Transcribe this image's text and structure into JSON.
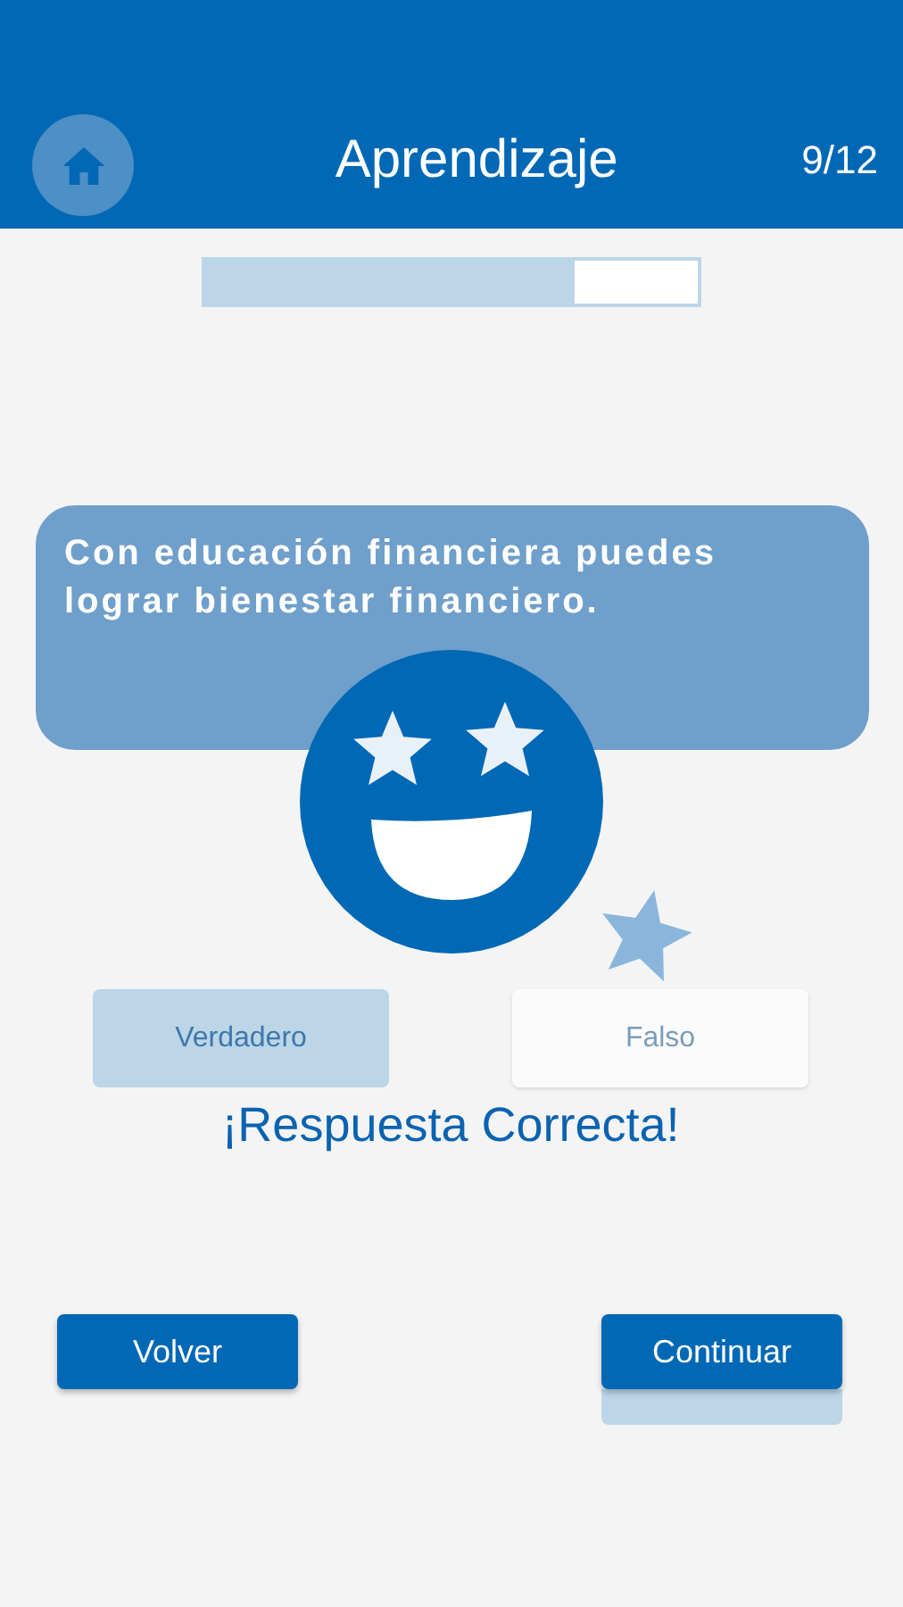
{
  "header": {
    "title": "Aprendizaje",
    "counter": "9/12"
  },
  "progress": {
    "level": 0.75
  },
  "question": {
    "text": "Con educación financiera puedes lograr bienestar financiero."
  },
  "options": [
    {
      "label": "Verdadero",
      "selected": true
    },
    {
      "label": "Falso",
      "selected": false
    }
  ],
  "feedback": {
    "text": "¡Respuesta Correcta!"
  },
  "verify_button": {
    "disabled": true
  },
  "buttons": [
    {
      "label": "Volver"
    },
    {
      "label": "Continuar"
    }
  ]
}
